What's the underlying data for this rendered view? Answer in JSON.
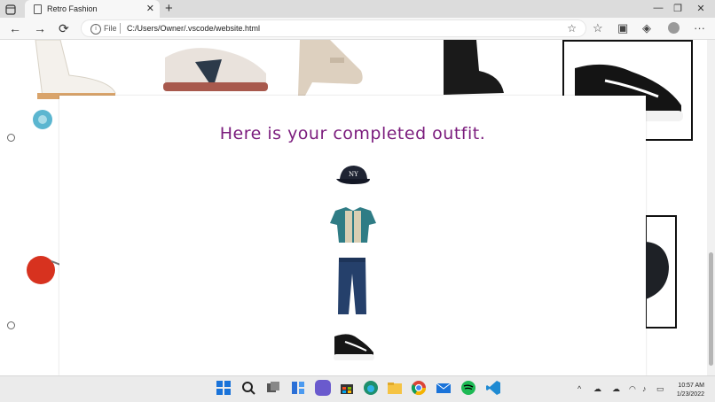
{
  "browser": {
    "tab_title": "Retro Fashion",
    "tab_close": "✕",
    "new_tab": "+",
    "window_controls": [
      "—",
      "❐",
      "✕"
    ],
    "nav": {
      "back": "←",
      "forward": "→",
      "refresh": "⟳"
    },
    "address": {
      "scheme": "File",
      "url": "C:/Users/Owner/.vscode/website.html"
    },
    "toolbar_icons": [
      "favorites-add-icon",
      "favorites-icon",
      "collections-icon",
      "extensions-icon",
      "profile-icon",
      "more-icon"
    ],
    "more": "···"
  },
  "page": {
    "outfit_heading": "Here is your completed outfit.",
    "outfit_items": [
      "cap-image",
      "shirt-image",
      "jeans-image",
      "sneaker-image"
    ],
    "background_items": [
      "roller-skate",
      "sneaker-brown",
      "mary-jane-heel",
      "black-boot",
      "black-sneaker",
      "red-sunglasses",
      "black-cap"
    ]
  },
  "taskbar": {
    "apps": [
      "start-icon",
      "search-icon",
      "task-view-icon",
      "widgets-icon",
      "teams-icon",
      "store-icon",
      "edge-icon",
      "file-explorer-icon",
      "chrome-icon",
      "mail-icon",
      "spotify-icon",
      "vscode-icon"
    ],
    "tray_chevron": "^",
    "time": "10:57 AM",
    "date": "1/23/2022"
  },
  "colors": {
    "heading": "#7b1c7d",
    "taskbar": "#ebebeb",
    "chrome_bg": "#dcdcdc"
  }
}
